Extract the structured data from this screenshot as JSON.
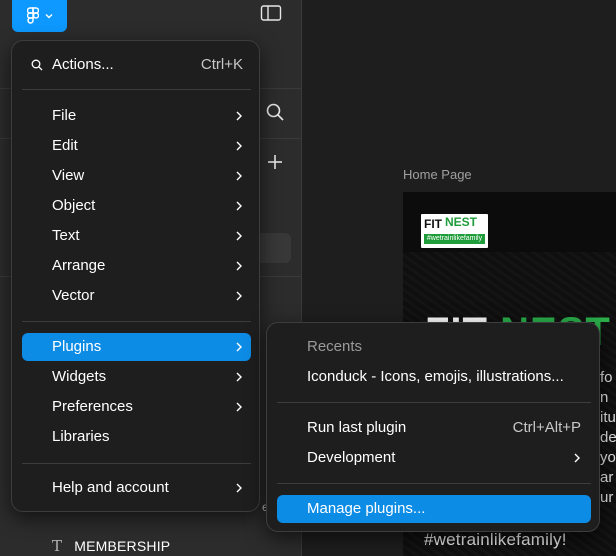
{
  "canvas": {
    "frame_label": "Home Page",
    "logo": {
      "word1": "FIT",
      "word2": "NEST",
      "tag": "#wetrainlikefamily"
    },
    "hero_word1": "FIT",
    "hero_word2": "NEST",
    "side_chars": [
      "fo",
      "n",
      "itu",
      "de",
      "yo",
      "ar",
      "ur"
    ],
    "hashtag": "#wetrainlikefamily!"
  },
  "left_panel": {
    "layer_label": "MEMBERSHIP",
    "peek_text": "e"
  },
  "menu": {
    "actions": {
      "label": "Actions...",
      "shortcut": "Ctrl+K"
    },
    "items_group1": [
      {
        "label": "File"
      },
      {
        "label": "Edit"
      },
      {
        "label": "View"
      },
      {
        "label": "Object"
      },
      {
        "label": "Text"
      },
      {
        "label": "Arrange"
      },
      {
        "label": "Vector"
      }
    ],
    "items_group2": [
      {
        "label": "Plugins"
      },
      {
        "label": "Widgets"
      },
      {
        "label": "Preferences"
      },
      {
        "label": "Libraries"
      }
    ],
    "help": {
      "label": "Help and account"
    }
  },
  "submenu": {
    "recents_heading": "Recents",
    "recent_item": "Iconduck - Icons, emojis, illustrations...",
    "run_last": {
      "label": "Run last plugin",
      "shortcut": "Ctrl+Alt+P"
    },
    "development": "Development",
    "manage": "Manage plugins..."
  },
  "colors": {
    "accent": "#0d8ce6",
    "brand_green": "#2bb24c",
    "menu_bg": "#1e1e1e"
  },
  "icons": [
    "figma-logo-icon",
    "chevron-down-icon",
    "panel-toggle-icon",
    "search-icon",
    "plus-icon",
    "chevron-right-icon",
    "text-type-icon"
  ]
}
